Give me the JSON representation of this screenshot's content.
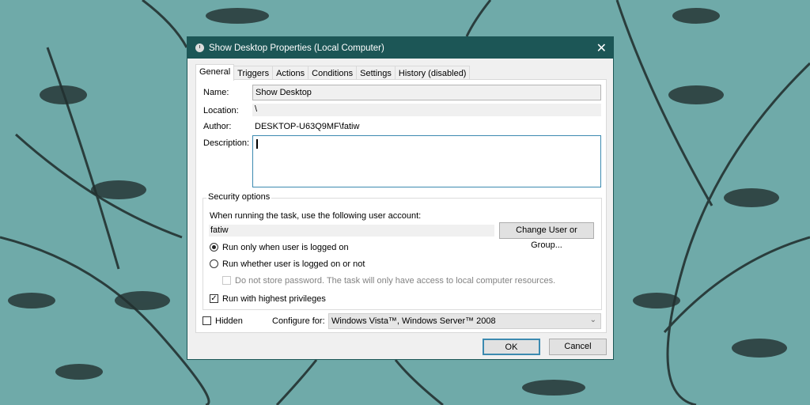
{
  "dialog": {
    "title": "Show Desktop Properties (Local Computer)",
    "close": "✕"
  },
  "tabs": [
    "General",
    "Triggers",
    "Actions",
    "Conditions",
    "Settings",
    "History (disabled)"
  ],
  "general": {
    "name_label": "Name:",
    "name_value": "Show Desktop",
    "location_label": "Location:",
    "location_value": "\\",
    "author_label": "Author:",
    "author_value": "DESKTOP-U63Q9MF\\fatiw",
    "description_label": "Description:",
    "description_value": ""
  },
  "security": {
    "title": "Security options",
    "account_prompt": "When running the task, use the following user account:",
    "account_value": "fatiw",
    "change_button": "Change User or Group...",
    "radio_logged_on": "Run only when user is logged on",
    "radio_whether": "Run whether user is logged on or not",
    "no_store_password": "Do not store password.  The task will only have access to local computer resources.",
    "highest_privileges": "Run with highest privileges",
    "selected": "Run only when user is logged on",
    "highest_checked": true,
    "no_store_checked": false
  },
  "bottom": {
    "hidden_label": "Hidden",
    "hidden_checked": false,
    "configure_label": "Configure for:",
    "configure_value": "Windows Vista™, Windows Server™ 2008"
  },
  "buttons": {
    "ok": "OK",
    "cancel": "Cancel"
  }
}
